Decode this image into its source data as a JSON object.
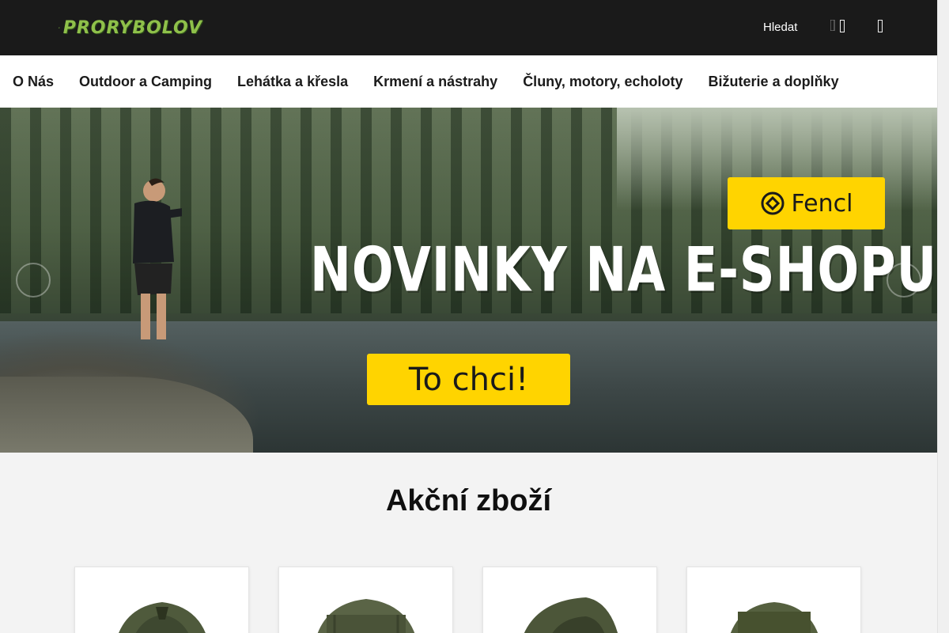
{
  "header": {
    "logo_text": "PRORYBOLOV",
    "search_label": "Hledat",
    "search_icon_glyph": "",
    "colors": {
      "topbar": "#1a1a1a",
      "logo": "#8fc04a"
    }
  },
  "nav": {
    "items": [
      {
        "label": "O Nás"
      },
      {
        "label": "Outdoor a Camping"
      },
      {
        "label": "Lehátka a křesla"
      },
      {
        "label": "Krmení a nástrahy"
      },
      {
        "label": "Čluny, motory, echoloty"
      },
      {
        "label": "Bižuterie a doplňky"
      }
    ],
    "more_glyph": ""
  },
  "hero": {
    "brand_badge": "Fencl",
    "headline": "NOVINKY NA E-SHOPU",
    "cta_label": "To chci!",
    "prev_glyph": "",
    "next_glyph": "",
    "accent_color": "#ffd400"
  },
  "section": {
    "title": "Akční zboží"
  },
  "products": [
    {
      "icon": "tent-icon"
    },
    {
      "icon": "bivvy-icon"
    },
    {
      "icon": "shelter-icon"
    },
    {
      "icon": "bivvy-icon"
    }
  ]
}
